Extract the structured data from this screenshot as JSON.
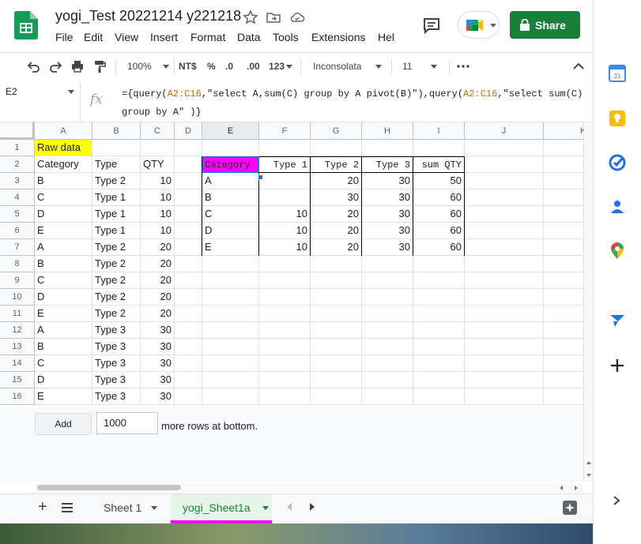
{
  "doc": {
    "title": "yogi_Test 20221214 y221218"
  },
  "menu": [
    "File",
    "Edit",
    "View",
    "Insert",
    "Format",
    "Data",
    "Tools",
    "Extensions",
    "Help"
  ],
  "header": {
    "share_label": "Share"
  },
  "toolbar": {
    "zoom": "100%",
    "currency": "NT$",
    "percent": "%",
    "dec_less": ".0",
    "dec_more": ".00",
    "format_more": "123",
    "font": "Inconsolata",
    "font_size": "11"
  },
  "formula_bar": {
    "cell_ref": "E2",
    "fx": "fx",
    "line1": {
      "a": "={query(",
      "r1": "A2:C16",
      "b": ",\"select A,sum(C) group by A pivot(B)\"),query(",
      "r2": "A2:C16",
      "c": ",\"select sum(C)"
    },
    "line2": "group by A\" )}"
  },
  "grid": {
    "columns": [
      "A",
      "B",
      "C",
      "D",
      "E",
      "F",
      "G",
      "H",
      "I",
      "J",
      "K"
    ],
    "rows": [
      "1",
      "2",
      "3",
      "4",
      "5",
      "6",
      "7",
      "8",
      "9",
      "10",
      "11",
      "12",
      "13",
      "14",
      "15",
      "16"
    ],
    "source_title": "Raw data",
    "source_headers": [
      "Category",
      "Type",
      "QTY"
    ],
    "source_rows": [
      [
        "B",
        "Type 2",
        "10"
      ],
      [
        "C",
        "Type 1",
        "10"
      ],
      [
        "D",
        "Type 1",
        "10"
      ],
      [
        "E",
        "Type 1",
        "10"
      ],
      [
        "A",
        "Type 2",
        "20"
      ],
      [
        "B",
        "Type 2",
        "20"
      ],
      [
        "C",
        "Type 2",
        "20"
      ],
      [
        "D",
        "Type 2",
        "20"
      ],
      [
        "E",
        "Type 2",
        "20"
      ],
      [
        "A",
        "Type 3",
        "30"
      ],
      [
        "B",
        "Type 3",
        "30"
      ],
      [
        "C",
        "Type 3",
        "30"
      ],
      [
        "D",
        "Type 3",
        "30"
      ],
      [
        "E",
        "Type 3",
        "30"
      ]
    ],
    "pivot_headers": [
      "Category",
      "Type 1",
      "Type 2",
      "Type 3",
      "sum QTY"
    ],
    "pivot_rows": [
      [
        "A",
        "",
        "20",
        "30",
        "50"
      ],
      [
        "B",
        "",
        "30",
        "30",
        "60"
      ],
      [
        "C",
        "10",
        "20",
        "30",
        "60"
      ],
      [
        "D",
        "10",
        "20",
        "30",
        "60"
      ],
      [
        "E",
        "10",
        "20",
        "30",
        "60"
      ]
    ]
  },
  "add_rows": {
    "button": "Add",
    "value": "1000",
    "suffix": "more rows at bottom."
  },
  "sheets": [
    {
      "name": "Sheet 1"
    },
    {
      "name": "yogi_Sheet1a"
    }
  ],
  "colors": {
    "brand_green": "#188038",
    "highlight_yellow": "#ffff00",
    "highlight_magenta": "#ff00ff",
    "range_orange": "#c07000"
  },
  "icons": [
    "sheets-logo-icon",
    "star-icon",
    "move-icon",
    "cloud-icon",
    "comment-icon",
    "meet-icon",
    "lock-icon",
    "undo-icon",
    "redo-icon",
    "print-icon",
    "paint-format-icon",
    "more-icon",
    "collapse-icon",
    "calendar-icon",
    "keep-icon",
    "tasks-icon",
    "contacts-icon",
    "maps-icon",
    "forms-icon",
    "plus-icon",
    "chevron-right-icon",
    "explore-icon"
  ]
}
